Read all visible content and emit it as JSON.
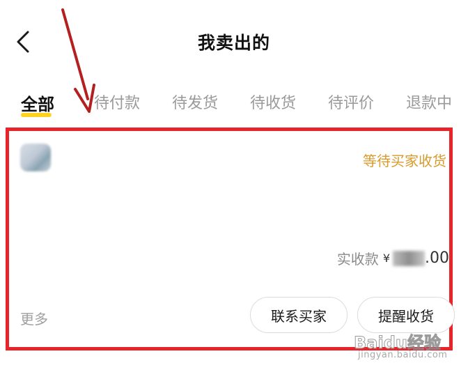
{
  "header": {
    "title": "我卖出的",
    "back_icon": "chevron-left-icon"
  },
  "tabs": [
    {
      "label": "全部",
      "active": true
    },
    {
      "label": "待付款",
      "active": false
    },
    {
      "label": "待发货",
      "active": false
    },
    {
      "label": "待收货",
      "active": false
    },
    {
      "label": "待评价",
      "active": false
    },
    {
      "label": "退款中",
      "active": false
    }
  ],
  "order": {
    "status": "等待买家收货",
    "amount_label": "实收款",
    "currency": "¥",
    "amount_decimal": ".00",
    "more_label": "更多",
    "contact_button": "联系买家",
    "remind_button": "提醒收货"
  },
  "watermark": {
    "brand": "Baidu经验",
    "sub": "jingyan.baidu.com"
  },
  "colors": {
    "accent_yellow": "#ffd21f",
    "status_orange": "#d99a2a",
    "highlight_red": "#e8232a",
    "arrow_red": "#b3201f"
  }
}
